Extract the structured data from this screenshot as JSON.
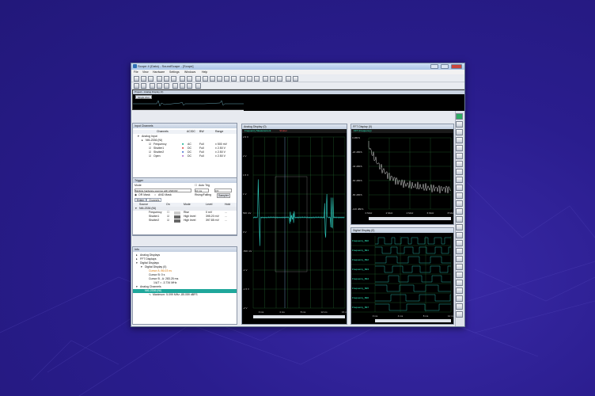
{
  "window": {
    "title": "Scope 4 (Data) - SoundScape - [Scope]"
  },
  "menu": [
    "File",
    "View",
    "Hardware",
    "Settings",
    "Windows",
    "Help"
  ],
  "overview": {
    "title": "Project - Analog Display (0)",
    "button": "Single shot"
  },
  "input_channels": {
    "title": "Input Channels",
    "headers": [
      "Channels",
      "AC/DC",
      "BW",
      "Range"
    ],
    "group": "Analog Input",
    "device": "NI6-2336 (NI)",
    "rows": [
      {
        "name": "Frequency",
        "coupling": "AC",
        "bw": "Full",
        "range": "± 500 mV"
      },
      {
        "name": "Shutter1",
        "coupling": "DC",
        "bw": "Full",
        "range": "± 2.50 V"
      },
      {
        "name": "Shutter2",
        "coupling": "DC",
        "bw": "Full",
        "range": "± 2.50 V"
      },
      {
        "name": "Open",
        "coupling": "DC",
        "bw": "Full",
        "range": "± 2.50 V"
      }
    ],
    "tabs": [
      "Clock",
      "Input Mode",
      "Timestamp",
      "Input Channels"
    ]
  },
  "trigger": {
    "title": "Trigger",
    "mode_label": "Mode",
    "auto_trig": "Auto Trig",
    "mode_value": "Multiple hardware sources with AND/OR",
    "time": "10 ms",
    "level": "0.5",
    "or_label": "OR Mask",
    "and_label": "AND Mask",
    "rising": "Rising/Falling",
    "sampler": "Sampler",
    "tabs": [
      "Extern",
      "Channels"
    ],
    "headers": [
      "Source",
      "On",
      "Mode",
      "Level",
      "Hold"
    ],
    "rows": [
      {
        "source": "NI6-2336 (NI)",
        "on": "",
        "mode": "",
        "level": "",
        "hold": ""
      },
      {
        "source": "Frequency",
        "on": "",
        "mode": "Rise",
        "level": "0 mV",
        "hold": "..."
      },
      {
        "source": "Shutter1",
        "on": "",
        "mode": "High level",
        "level": "395.20 mV",
        "hold": "..."
      },
      {
        "source": "Shutter2",
        "on": "",
        "mode": "High level",
        "level": "397.85 mV",
        "hold": "..."
      }
    ]
  },
  "info": {
    "title": "Info",
    "items": [
      {
        "text": "Analog Displays",
        "indent": 0
      },
      {
        "text": "FFT Displays",
        "indent": 0
      },
      {
        "text": "Digital Displays",
        "indent": 0
      },
      {
        "text": "Digital Display (0)",
        "indent": 1
      },
      {
        "text": "Cursor A: 86.03 ns",
        "indent": 2,
        "color": "#d97706"
      },
      {
        "text": "Cursor B: 0 s",
        "indent": 2
      },
      {
        "text": "Cursor B - A: 283.25 ms",
        "indent": 2
      },
      {
        "text": "1/ΔT = -3.734 MHz",
        "indent": 3
      },
      {
        "text": "Analog Channels",
        "indent": 0
      },
      {
        "text": "NI6-2336 (NI)",
        "indent": 1,
        "selected": true
      },
      {
        "text": "Maximum: 5.099 MHz -85.059 dBFS",
        "indent": 2
      }
    ]
  },
  "analog_display": {
    "title": "Analog Display (0)",
    "header": "Frequency Measurement",
    "header2": "Shutter",
    "yticks": [
      "2.5 V",
      "2 V",
      "1.5 V",
      "1 V",
      "500 mV",
      "0 V",
      "-500 mV",
      "-1 V",
      "-1.5 V",
      "-2 V"
    ],
    "xticks": [
      "0 ms",
      "4 ms",
      "8 ms",
      "12 ms",
      "16 ms"
    ]
  },
  "fft_display": {
    "title": "FFT Display (0)",
    "header": "FFT (Frequency)",
    "yticks": [
      "0 dBFS",
      "-20 dBFS",
      "-40 dBFS",
      "-60 dBFS",
      "-80 dBFS",
      "-100 dBFS"
    ],
    "xticks": [
      "0 MHz",
      "2 MHz",
      "4 MHz",
      "6 MHz",
      "8 MHz"
    ]
  },
  "digital_display": {
    "title": "Digital Display (0)",
    "channels": [
      "Frequency_Bit0",
      "Frequency_Bit1",
      "Frequency_Bit2",
      "Frequency_Bit3",
      "Frequency_Bit4",
      "Frequency_Bit5",
      "Frequency_Bit6",
      "Frequency_Bit7"
    ],
    "xticks": [
      "0 ms",
      "4 ms",
      "8 ms",
      "12 ms"
    ]
  },
  "colors": {
    "background": "#2a1d8e",
    "trace": "#2fd3c4",
    "scope_bg": "#000000",
    "grid": "#2f7f3f"
  }
}
